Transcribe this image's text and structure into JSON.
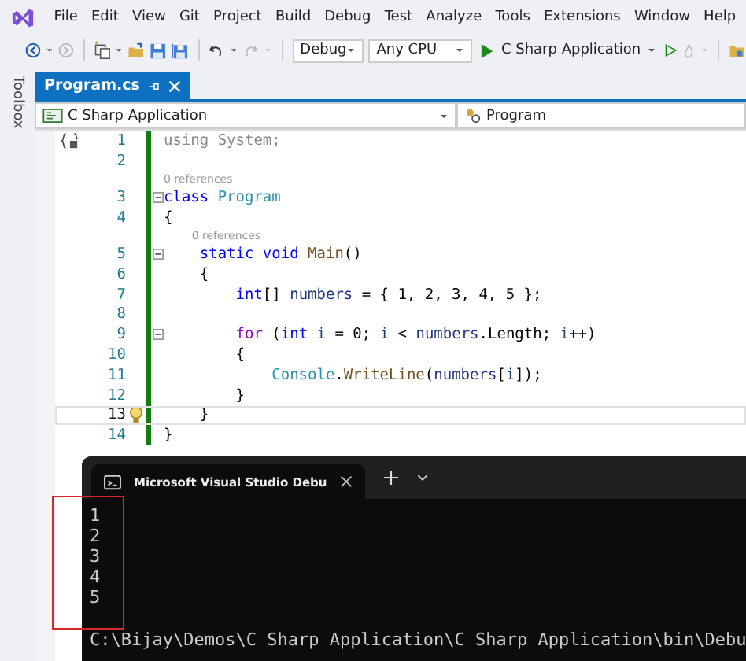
{
  "menu": [
    "File",
    "Edit",
    "View",
    "Git",
    "Project",
    "Build",
    "Debug",
    "Test",
    "Analyze",
    "Tools",
    "Extensions",
    "Window",
    "Help"
  ],
  "toolbar": {
    "configuration": "Debug",
    "platform": "Any CPU",
    "start": "C Sharp Application"
  },
  "side_panel": {
    "label": "Toolbox"
  },
  "tabs": [
    {
      "label": "Program.cs",
      "selected": true
    }
  ],
  "nav_bar": {
    "project": "C Sharp Application",
    "type": "Program"
  },
  "code": {
    "lines": [
      {
        "number": "1",
        "scope_icon": true,
        "tokens": [
          {
            "text": "using System;",
            "kind": "faded"
          }
        ]
      },
      {
        "number": "2"
      },
      {
        "number": "3",
        "fold": true,
        "lens": "0 references",
        "tokens": [
          {
            "text": "class",
            "kind": "keyword"
          },
          {
            "text": " Program",
            "kind": "type"
          }
        ]
      },
      {
        "number": "4",
        "tokens": [
          {
            "text": "{",
            "kind": "plain"
          }
        ]
      },
      {
        "number": "5",
        "fold": true,
        "lens": "0 references",
        "tokens": [
          {
            "text": "    static",
            "kind": "keyword"
          },
          {
            "text": " void",
            "kind": "keyword"
          },
          {
            "text": " Main",
            "kind": "method"
          },
          {
            "text": "()",
            "kind": "plain"
          }
        ]
      },
      {
        "number": "6",
        "tokens": [
          {
            "text": "    {",
            "kind": "plain"
          }
        ]
      },
      {
        "number": "7",
        "tokens": [
          {
            "text": "        int",
            "kind": "keyword"
          },
          {
            "text": "[] ",
            "kind": "plain"
          },
          {
            "text": "numbers",
            "kind": "variable"
          },
          {
            "text": " = { 1, 2, 3, 4, 5 };",
            "kind": "plain"
          }
        ]
      },
      {
        "number": "8"
      },
      {
        "number": "9",
        "fold": true,
        "tokens": [
          {
            "text": "        for",
            "kind": "control"
          },
          {
            "text": " (",
            "kind": "plain"
          },
          {
            "text": "int",
            "kind": "keyword"
          },
          {
            "text": " i",
            "kind": "variable"
          },
          {
            "text": " = 0; ",
            "kind": "plain"
          },
          {
            "text": "i",
            "kind": "variable"
          },
          {
            "text": " < ",
            "kind": "plain"
          },
          {
            "text": "numbers",
            "kind": "variable"
          },
          {
            "text": ".Length; ",
            "kind": "plain"
          },
          {
            "text": "i",
            "kind": "variable"
          },
          {
            "text": "++)",
            "kind": "plain"
          }
        ]
      },
      {
        "number": "10",
        "tokens": [
          {
            "text": "        {",
            "kind": "plain"
          }
        ]
      },
      {
        "number": "11",
        "tokens": [
          {
            "text": "            Console",
            "kind": "type"
          },
          {
            "text": ".",
            "kind": "plain"
          },
          {
            "text": "WriteLine",
            "kind": "method"
          },
          {
            "text": "(",
            "kind": "plain"
          },
          {
            "text": "numbers",
            "kind": "variable"
          },
          {
            "text": "[",
            "kind": "plain"
          },
          {
            "text": "i",
            "kind": "variable"
          },
          {
            "text": "]);",
            "kind": "plain"
          }
        ]
      },
      {
        "number": "12",
        "tokens": [
          {
            "text": "        }",
            "kind": "plain"
          }
        ]
      },
      {
        "number": "13",
        "current": true,
        "lightbulb": true,
        "tokens": [
          {
            "text": "    }",
            "kind": "plain"
          }
        ]
      },
      {
        "number": "14",
        "tokens": [
          {
            "text": "}",
            "kind": "plain"
          }
        ]
      }
    ]
  },
  "console": {
    "tab": "Microsoft Visual Studio Debu",
    "output": [
      "1",
      "2",
      "3",
      "4",
      "5"
    ],
    "path": "C:\\Bijay\\Demos\\C Sharp Application\\C Sharp Application\\bin\\Debu"
  }
}
